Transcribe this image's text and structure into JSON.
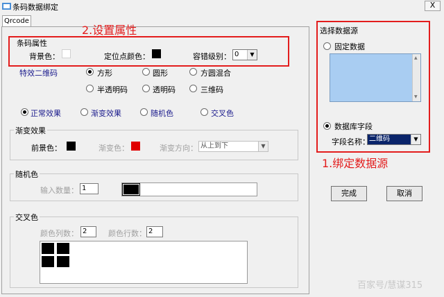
{
  "window": {
    "title": "条码数据绑定",
    "close_label": "X"
  },
  "tabs": [
    {
      "label": "Qrcode"
    }
  ],
  "annotations": {
    "set_attributes": "2.设置属性",
    "bind_source": "1.绑定数据源"
  },
  "barcode_props": {
    "legend": "条码属性",
    "bg_label": "背景色：",
    "bg_color": "#ffffff",
    "anchor_label": "定位点颜色：",
    "anchor_color": "#000000",
    "ecc_label": "容错级别：",
    "ecc_value": "0"
  },
  "effect_qr": {
    "label": "特效二维码",
    "options": [
      "方形",
      "圆形",
      "方圆混合",
      "半透明码",
      "透明码",
      "三维码"
    ],
    "selected": "方形"
  },
  "effect_mode": {
    "options": [
      "正常效果",
      "渐变效果",
      "随机色",
      "交叉色"
    ],
    "selected": "正常效果"
  },
  "gradient": {
    "legend": "渐变效果",
    "fg_label": "前景色：",
    "fg_color": "#000000",
    "grad_label": "渐变色：",
    "grad_color": "#e00000",
    "dir_label": "渐变方向：",
    "dir_value": "从上到下"
  },
  "random": {
    "legend": "随机色",
    "count_label": "输入数量：",
    "count_value": "1"
  },
  "cross": {
    "legend": "交叉色",
    "cols_label": "颜色列数：",
    "cols_value": "2",
    "rows_label": "颜色行数：",
    "rows_value": "2"
  },
  "data_source": {
    "legend": "选择数据源",
    "fixed_label": "固定数据",
    "db_label": "数据库字段",
    "field_label": "字段名称：",
    "field_value": "二维码",
    "selected": "数据库字段"
  },
  "buttons": {
    "ok": "完成",
    "cancel": "取消"
  },
  "watermark": "百家号/慧谋315"
}
